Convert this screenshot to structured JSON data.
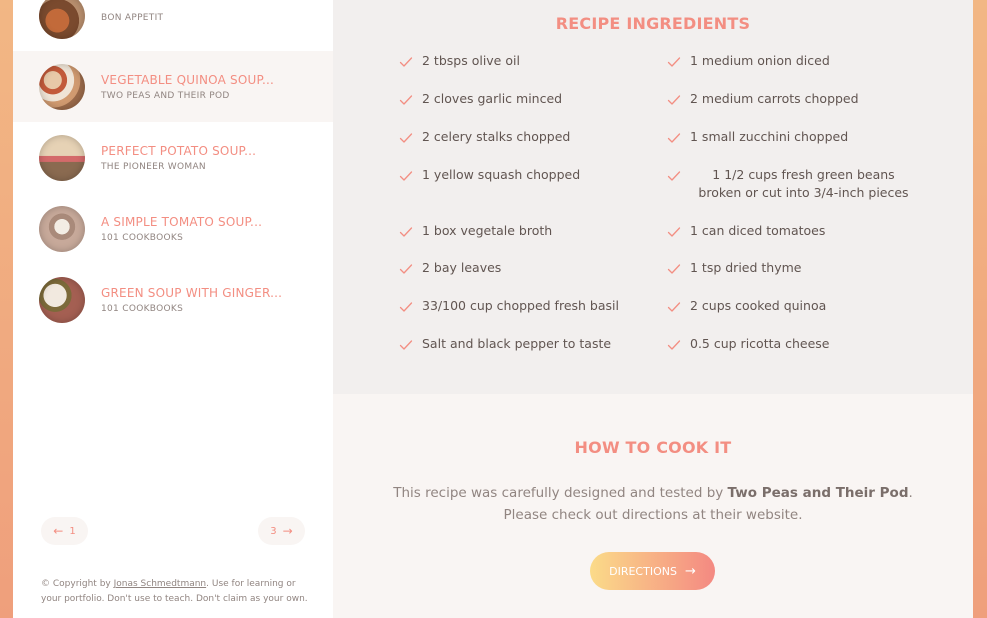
{
  "sidebar": {
    "results": [
      {
        "title": "",
        "publisher": "BON APPETIT",
        "active": false
      },
      {
        "title": "VEGETABLE QUINOA SOUP...",
        "publisher": "TWO PEAS AND THEIR POD",
        "active": true
      },
      {
        "title": "PERFECT POTATO SOUP...",
        "publisher": "THE PIONEER WOMAN",
        "active": false
      },
      {
        "title": "A SIMPLE TOMATO SOUP...",
        "publisher": "101 COOKBOOKS",
        "active": false
      },
      {
        "title": "GREEN SOUP WITH GINGER...",
        "publisher": "101 COOKBOOKS",
        "active": false
      }
    ],
    "pagination": {
      "prev_label": "1",
      "next_label": "3"
    },
    "copyright": {
      "prefix": "© Copyright by ",
      "author": "Jonas Schmedtmann",
      "suffix": ". Use for learning or your portfolio. Don't use to teach. Don't claim as your own."
    }
  },
  "ingredients": {
    "heading": "RECIPE INGREDIENTS",
    "items": [
      "2 tbsps olive oil",
      "1 medium onion diced",
      "2 cloves garlic minced",
      "2 medium carrots chopped",
      "2 celery stalks chopped",
      "1 small zucchini chopped",
      "1 yellow squash chopped",
      "1 1/2 cups fresh green beans broken or cut into 3/4-inch pieces",
      "1 box vegetale broth",
      "1 can diced tomatoes",
      "2 bay leaves",
      "1 tsp dried thyme",
      "33/100 cup chopped fresh basil",
      "2 cups cooked quinoa",
      " Salt and black pepper to taste",
      "0.5 cup ricotta cheese"
    ]
  },
  "directions": {
    "heading": "HOW TO COOK IT",
    "text_prefix": "This recipe was carefully designed and tested by ",
    "publisher": "Two Peas and Their Pod",
    "text_suffix": ". Please check out directions at their website.",
    "button_label": "DIRECTIONS"
  },
  "colors": {
    "accent": "#f38e82",
    "text": "#615551",
    "muted": "#918581",
    "gradient_start": "#fbdb89",
    "gradient_end": "#f48982"
  }
}
